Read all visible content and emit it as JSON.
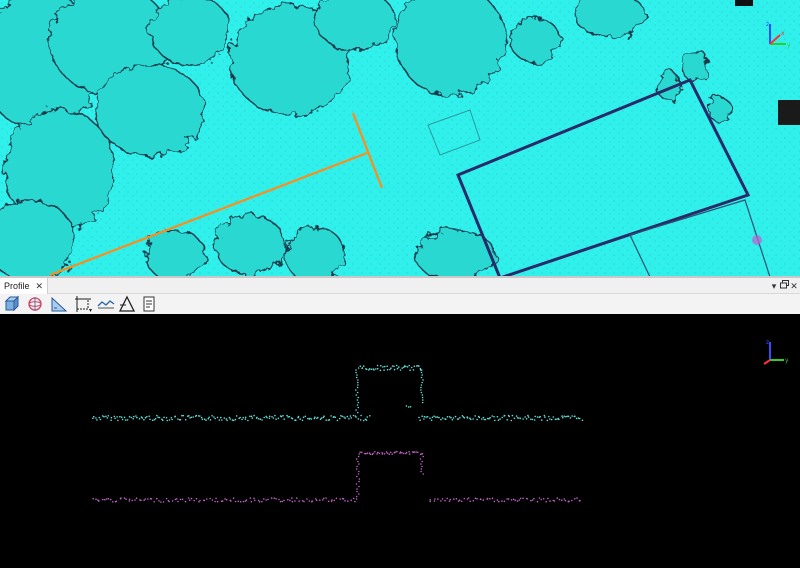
{
  "app": {
    "map_view": {
      "name": "plan-view"
    },
    "profile_panel": {
      "tab_label": "Profile",
      "close_symbol": "✕",
      "window_controls": [
        "▾",
        "🗗",
        "✕"
      ]
    },
    "toolbar": {
      "tools": [
        {
          "icon": "cube-view-icon"
        },
        {
          "icon": "orbit-icon"
        },
        {
          "icon": "measure-slope-icon"
        },
        {
          "icon": "select-box-icon"
        },
        {
          "icon": "profile-align-icon"
        },
        {
          "icon": "triangle-measure-icon"
        },
        {
          "icon": "report-icon"
        }
      ]
    },
    "colors": {
      "ground_cyan": "#2ff0ea",
      "section_line": "#ff8c1a",
      "profile_cyan": "#5fe0d6",
      "profile_magenta": "#c060c8",
      "axis_x": "#2ecc2e",
      "axis_y": "#ff3030",
      "axis_z": "#3050ff"
    }
  }
}
